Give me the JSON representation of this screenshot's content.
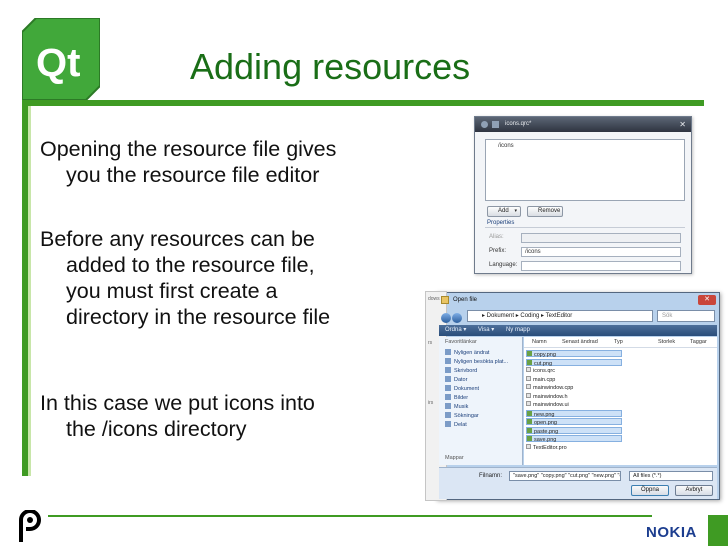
{
  "slide": {
    "title": "Adding resources",
    "bullets": [
      "Opening the resource file gives\nyou the resource file editor",
      "Before any resources can be\nadded to the resource file,\nyou must first create a\ndirectory in the resource file",
      "In this case we put icons into\nthe /icons directory"
    ],
    "logo_text": "Qt",
    "footer_brand": "NOKIA"
  },
  "resource_editor": {
    "window_title": "icons.qrc*",
    "close_glyph": "✕",
    "tree_items": [
      "/icons"
    ],
    "buttons": {
      "add": "Add",
      "add_caret": "▾",
      "remove": "Remove"
    },
    "properties_label": "Properties",
    "fields": [
      {
        "label": "Alias:",
        "value": ""
      },
      {
        "label": "Prefix:",
        "value": "/icons"
      },
      {
        "label": "Language:",
        "value": ""
      }
    ]
  },
  "open_dialog": {
    "background_labels": [
      "dows",
      "rs",
      "irs"
    ],
    "title": "Open file",
    "close_glyph": "✕",
    "address": "▸ Dokument ▸ Coding ▸ TextEditor",
    "search_placeholder": "Sök",
    "toolbar": [
      "Ordna ▾",
      "Visa ▾",
      "Ny mapp"
    ],
    "favorites_header": "Favoritlänkar",
    "favorites": [
      "Nyligen ändrat",
      "Nyligen besökta plat...",
      "Skrivbord",
      "Dator",
      "Dokument",
      "Bilder",
      "Musik",
      "Sökningar",
      "Delat"
    ],
    "folders_label": "Mappar",
    "columns": [
      "Namn",
      "Senast ändrad",
      "Typ",
      "Storlek",
      "Taggar"
    ],
    "files": [
      {
        "name": "copy.png",
        "selected": true,
        "icon": "image-file-icon"
      },
      {
        "name": "cut.png",
        "selected": true,
        "icon": "image-file-icon"
      },
      {
        "name": "icons.qrc",
        "selected": false,
        "icon": "plain-file-icon"
      },
      {
        "name": "main.cpp",
        "selected": false,
        "icon": "plain-file-icon"
      },
      {
        "name": "mainwindow.cpp",
        "selected": false,
        "icon": "plain-file-icon"
      },
      {
        "name": "mainwindow.h",
        "selected": false,
        "icon": "plain-file-icon"
      },
      {
        "name": "mainwindow.ui",
        "selected": false,
        "icon": "plain-file-icon"
      },
      {
        "name": "new.png",
        "selected": true,
        "icon": "image-file-icon"
      },
      {
        "name": "open.png",
        "selected": true,
        "icon": "image-file-icon"
      },
      {
        "name": "paste.png",
        "selected": true,
        "icon": "image-file-icon"
      },
      {
        "name": "save.png",
        "selected": true,
        "icon": "image-file-icon"
      },
      {
        "name": "TextEditor.pro",
        "selected": false,
        "icon": "plain-file-icon"
      }
    ],
    "filename_label": "Filnamn:",
    "filename_value": "\"save.png\" \"copy.png\" \"cut.png\" \"new.png\" \"o",
    "filter_value": "All files (*.*)",
    "buttons": {
      "open": "Öppna",
      "cancel": "Avbryt"
    }
  },
  "colors": {
    "title_green": "#1a6e17",
    "accent_green": "#3f9b23",
    "nokia_blue": "#1c3d8f"
  }
}
